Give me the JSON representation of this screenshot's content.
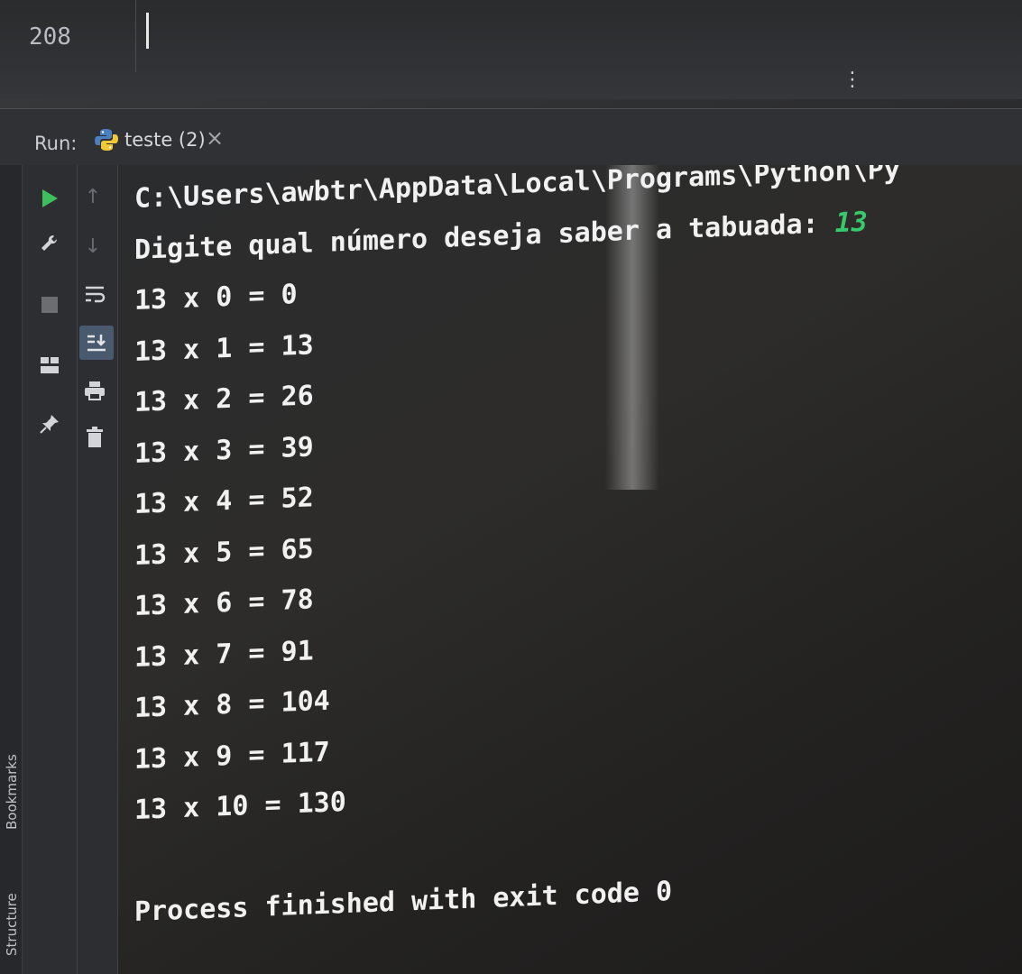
{
  "editor": {
    "line_number": "208"
  },
  "run_window": {
    "label": "Run:",
    "tab_label": "teste (2)",
    "tab_close": "×"
  },
  "side_panels": {
    "bookmarks_label": "Bookmarks",
    "structure_label": "Structure"
  },
  "console": {
    "path_line": "C:\\Users\\awbtr\\AppData\\Local\\Programs\\Python\\Py",
    "prompt": "Digite qual número deseja saber a tabuada: ",
    "input_value": "13",
    "table": [
      "13 x 0 = 0",
      "13 x 1 = 13",
      "13 x 2 = 26",
      "13 x 3 = 39",
      "13 x 4 = 52",
      "13 x 5 = 65",
      "13 x 6 = 78",
      "13 x 7 = 91",
      "13 x 8 = 104",
      "13 x 9 = 117",
      "13 x 10 = 130"
    ],
    "blank_line": "",
    "finish_message": "Process finished with exit code 0"
  },
  "colors": {
    "input_value": "#38c96a",
    "run_green": "#3fbf5b",
    "tab_underline": "#6f8fbf"
  },
  "icons": {
    "toolbar_left": [
      "run-icon",
      "wrench-icon",
      "stop-icon",
      "layout-icon",
      "pin-icon"
    ],
    "toolbar_right": [
      "arrow-up-icon",
      "arrow-down-icon",
      "soft-wrap-icon",
      "scroll-to-end-icon",
      "print-icon",
      "trash-icon"
    ]
  }
}
